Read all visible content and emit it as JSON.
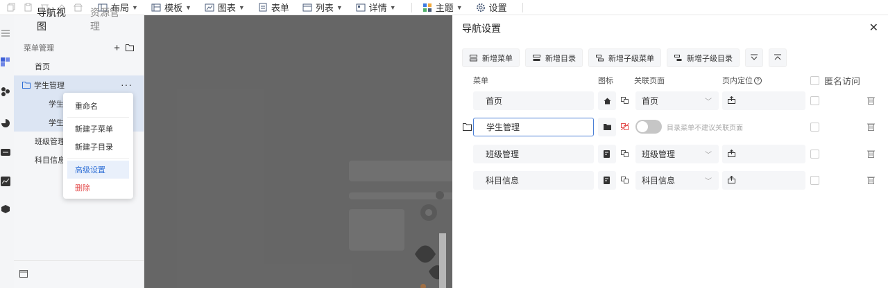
{
  "toolbar": {
    "items": [
      {
        "label": "布局",
        "icon": "layout-icon"
      },
      {
        "label": "模板",
        "icon": "template-icon"
      },
      {
        "label": "图表",
        "icon": "chart-icon"
      },
      {
        "label": "表单",
        "icon": "form-icon"
      },
      {
        "label": "列表",
        "icon": "list-icon"
      },
      {
        "label": "详情",
        "icon": "detail-icon"
      }
    ],
    "theme_label": "主题",
    "settings_label": "设置"
  },
  "nav": {
    "tabs": [
      "导航视图",
      "资源管理"
    ],
    "menu_head": "菜单管理",
    "items": {
      "home": "首页",
      "students": "学生管理",
      "student_child_1": "学生信息",
      "student_child_2": "学生成绩",
      "classes": "班级管理",
      "subjects": "科目信息"
    }
  },
  "context_menu": {
    "rename": "重命名",
    "new_submenu": "新建子菜单",
    "new_subdir": "新建子目录",
    "advanced": "高级设置",
    "delete": "删除"
  },
  "drawer": {
    "title": "导航设置",
    "buttons": {
      "add_menu": "新增菜单",
      "add_dir": "新增目录",
      "add_submenu": "新增子级菜单",
      "add_subdir": "新增子级目录"
    },
    "headers": {
      "menu": "菜单",
      "icon": "图标",
      "page": "关联页面",
      "anchor": "页内定位",
      "anon": "匿名访问"
    },
    "rows": [
      {
        "name": "首页",
        "page": "首页"
      },
      {
        "name": "学生管理",
        "hint": "目录菜单不建议关联页面"
      },
      {
        "name": "班级管理",
        "page": "班级管理"
      },
      {
        "name": "科目信息",
        "page": "科目信息"
      }
    ]
  },
  "colors": {
    "accent": "#2f6fd6",
    "danger": "#e34d4d",
    "selected_bg": "#dce5f3"
  }
}
